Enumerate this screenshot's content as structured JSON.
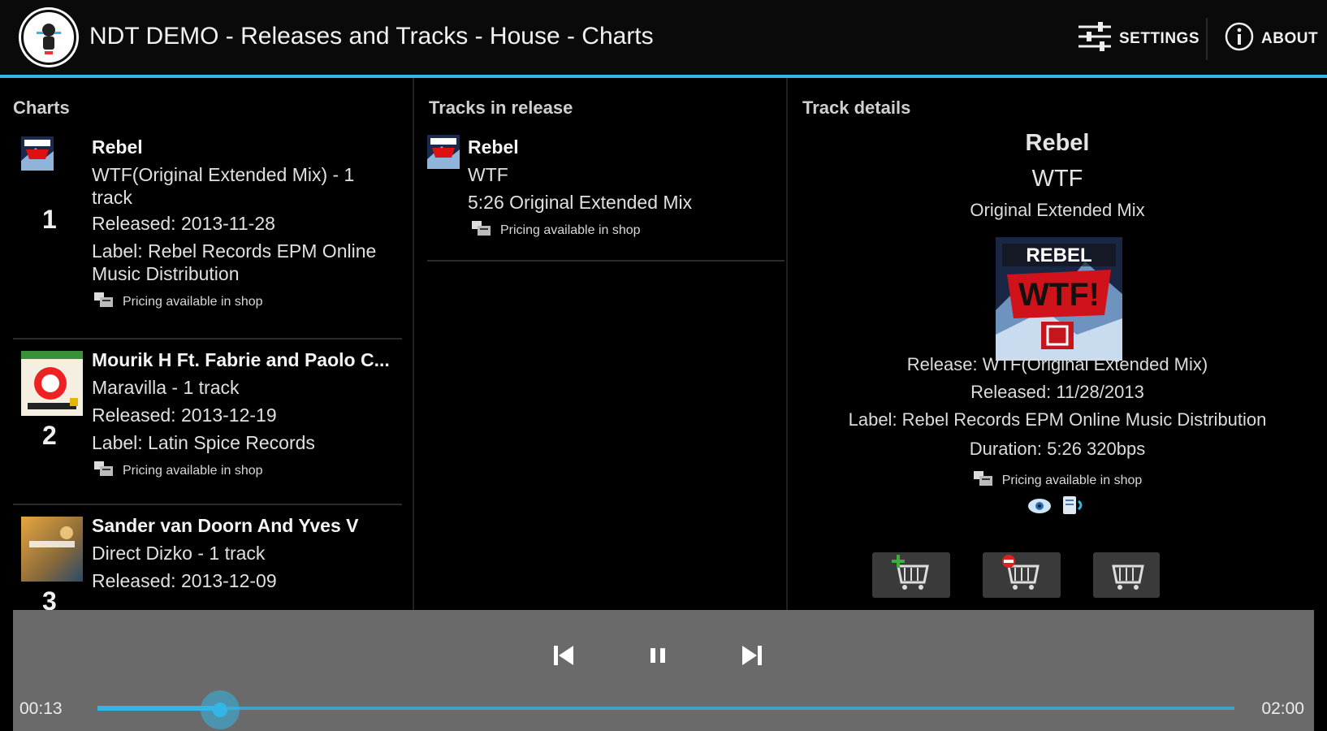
{
  "app": {
    "title": "NDT DEMO - Releases and Tracks - House - Charts",
    "settings_label": "SETTINGS",
    "about_label": "ABOUT",
    "accent_color": "#33b5e5"
  },
  "charts": {
    "header": "Charts",
    "items": [
      {
        "rank": "1",
        "artist": "Rebel",
        "release_line1": "WTF(Original Extended Mix) - 1",
        "release_line2": "track",
        "released": "Released: 2013-11-28",
        "label_line1": "Label: Rebel Records EPM Online",
        "label_line2": "Music Distribution",
        "pricing": "Pricing available in shop",
        "cover_icon": "rebel-wtf-cover"
      },
      {
        "rank": "2",
        "artist": "Mourik H Ft. Fabrie and Paolo C...",
        "release_line1": "Maravilla - 1 track",
        "released": "Released: 2013-12-19",
        "label_line1": "Label: Latin Spice Records",
        "pricing": "Pricing available in shop",
        "cover_icon": "latin-spice-cover"
      },
      {
        "rank": "3",
        "artist": "Sander van Doorn And Yves V",
        "release_line1": "Direct Dizko - 1 track",
        "released": "Released: 2013-12-09",
        "cover_icon": "direct-dizko-cover"
      }
    ]
  },
  "tracks": {
    "header": "Tracks in release",
    "items": [
      {
        "artist": "Rebel",
        "title": "WTF",
        "mix": "5:26 Original Extended Mix",
        "pricing": "Pricing available in shop"
      }
    ]
  },
  "details": {
    "header": "Track details",
    "artist": "Rebel",
    "title": "WTF",
    "mix": "Original Extended Mix",
    "release": "Release: WTF(Original Extended Mix)",
    "released": "Released: 11/28/2013",
    "label": "Label: Rebel Records EPM Online Music Distribution",
    "duration": "Duration: 5:26 320bps",
    "pricing": "Pricing available in shop",
    "cover_text": "REBEL",
    "cover_big_text": "WTF!"
  },
  "player": {
    "current_time": "00:13",
    "total_time": "02:00",
    "progress_fraction": 0.108
  }
}
